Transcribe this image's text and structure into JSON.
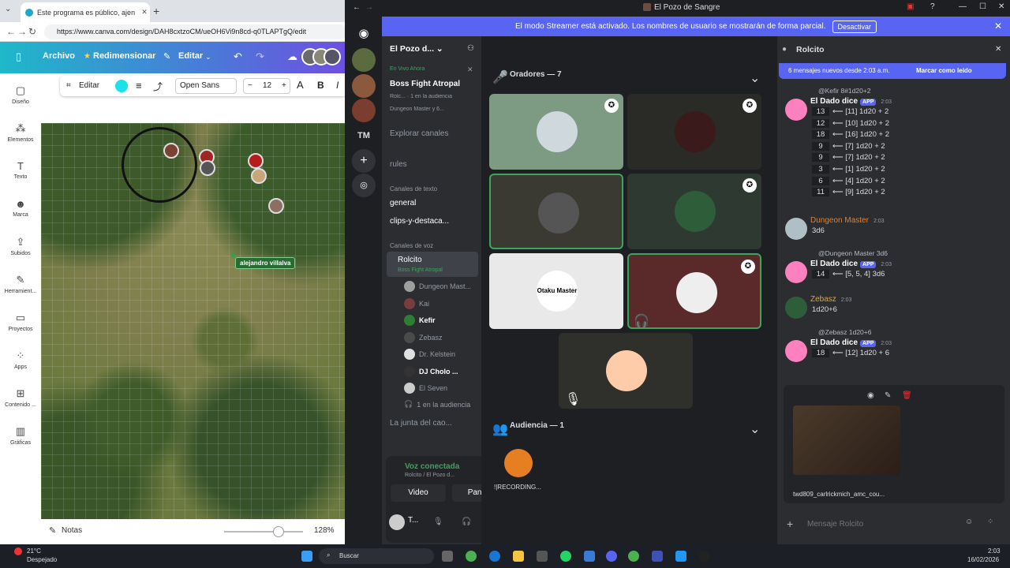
{
  "browser": {
    "tab_title": "Este programa es público, ajeno a...",
    "url": "https://www.canva.com/design/DAH8cxtzoCM/ueOH6Vi9n8cd-q0TLAPTgQ/edit",
    "menu": {
      "file": "Archivo",
      "resize": "Redimensionar",
      "edit": "Editar"
    },
    "toolbar": {
      "edit": "Editar",
      "font": "Open Sans",
      "size": "12",
      "bold": "B",
      "italic": "I",
      "minus": "−",
      "plus": "+"
    },
    "sidebar": [
      {
        "label": "Diseño",
        "icon": "design-icon"
      },
      {
        "label": "Elementos",
        "icon": "elements-icon"
      },
      {
        "label": "Texto",
        "icon": "text-icon"
      },
      {
        "label": "Marca",
        "icon": "brand-icon"
      },
      {
        "label": "Subidos",
        "icon": "upload-icon"
      },
      {
        "label": "Herramient...",
        "icon": "tools-icon"
      },
      {
        "label": "Proyectos",
        "icon": "projects-icon"
      },
      {
        "label": "Apps",
        "icon": "apps-icon"
      },
      {
        "label": "Contenido ...",
        "icon": "content-icon"
      },
      {
        "label": "Gráficas",
        "icon": "charts-icon"
      }
    ],
    "player_label": "alejandro villalva",
    "footer": {
      "notes": "Notas",
      "zoom": "128%"
    }
  },
  "discord": {
    "window_title": "El Pozo de Sangre",
    "banner": {
      "text": "El modo Streamer está activado. Los nombres de usuario se mostrarán de forma parcial.",
      "button": "Desactivar"
    },
    "server_name": "El Pozo d...",
    "live": {
      "label": "En Vivo Ahora",
      "title": "Boss Fight Atropal",
      "meta1": "Rolc...",
      "meta1b": "1 en la audiencia",
      "meta2": "Dungeon Master y 6..."
    },
    "channels": {
      "explore": "Explorar canales",
      "rules": "rules",
      "text_header": "Canales de texto",
      "general": "general",
      "clips": "clips-y-destaca...",
      "voice_header": "Canales de voz",
      "active_voice": "Rolcito",
      "active_voice_sub": "Boss Fight Atropal",
      "audience": "1 en la audiencia",
      "other_voice": "La junta del cao..."
    },
    "voice_users": [
      "Dungeon Mast...",
      "Kai",
      "Kefir",
      "Zebasz",
      "Dr. Kelstein",
      "DJ Cholo ...",
      "El Seven"
    ],
    "vc": {
      "status": "Voz conectada",
      "sub": "Rolcito / El Pozo d...",
      "video": "Video",
      "screen": "Pantall",
      "user": "T..."
    },
    "stage": {
      "speakers": "Oradores — 7",
      "audience": "Audiencia — 1",
      "audience_user": "!|RECORDING...",
      "tile_text": "Otaku Master"
    },
    "chat": {
      "title": "Rolcito",
      "new_msgs": "6 mensajes nuevos desde 2:03 a.m.",
      "mark_read": "Marcar como leído",
      "placeholder": "Mensaje Rolcito",
      "attachment": "twd809_carlrickmich_amc_cou...",
      "messages": [
        {
          "reply": "@Kefir 8#1d20+2",
          "author": "El Dado dice",
          "app": "APP",
          "time": "2:03",
          "rolls": [
            [
              "13",
              "⟵ [11] 1d20 + 2"
            ],
            [
              "12",
              "⟵ [10] 1d20 + 2"
            ],
            [
              "18",
              "⟵ [16] 1d20 + 2"
            ],
            [
              "9",
              "⟵ [7] 1d20 + 2"
            ],
            [
              "9",
              "⟵ [7] 1d20 + 2"
            ],
            [
              "3",
              "⟵ [1] 1d20 + 2"
            ],
            [
              "6",
              "⟵ [4] 1d20 + 2"
            ],
            [
              "11",
              "⟵ [9] 1d20 + 2"
            ]
          ]
        },
        {
          "author": "Dungeon Master",
          "time": "2:03",
          "text": "3d6"
        },
        {
          "reply": "@Dungeon Master 3d6",
          "author": "El Dado dice",
          "app": "APP",
          "time": "2:03",
          "rolls": [
            [
              "14",
              "⟵ [5, 5, 4] 3d6"
            ]
          ]
        },
        {
          "author": "Zebasz",
          "time": "2:03",
          "text": "1d20+6"
        },
        {
          "reply": "@Zebasz 1d20+6",
          "author": "El Dado dice",
          "app": "APP",
          "time": "2:03",
          "rolls": [
            [
              "18",
              "⟵ [12] 1d20 + 6"
            ]
          ]
        }
      ]
    }
  },
  "taskbar": {
    "temp": "21°C",
    "weather": "Despejado",
    "search": "Buscar",
    "time": "2:03",
    "date": "16/02/2026"
  },
  "colors": {
    "discord_blurple": "#5865f2",
    "speaking_green": "#3ba55c",
    "dm_name": "#e67e22",
    "zebasz_name": "#e6a23c"
  }
}
